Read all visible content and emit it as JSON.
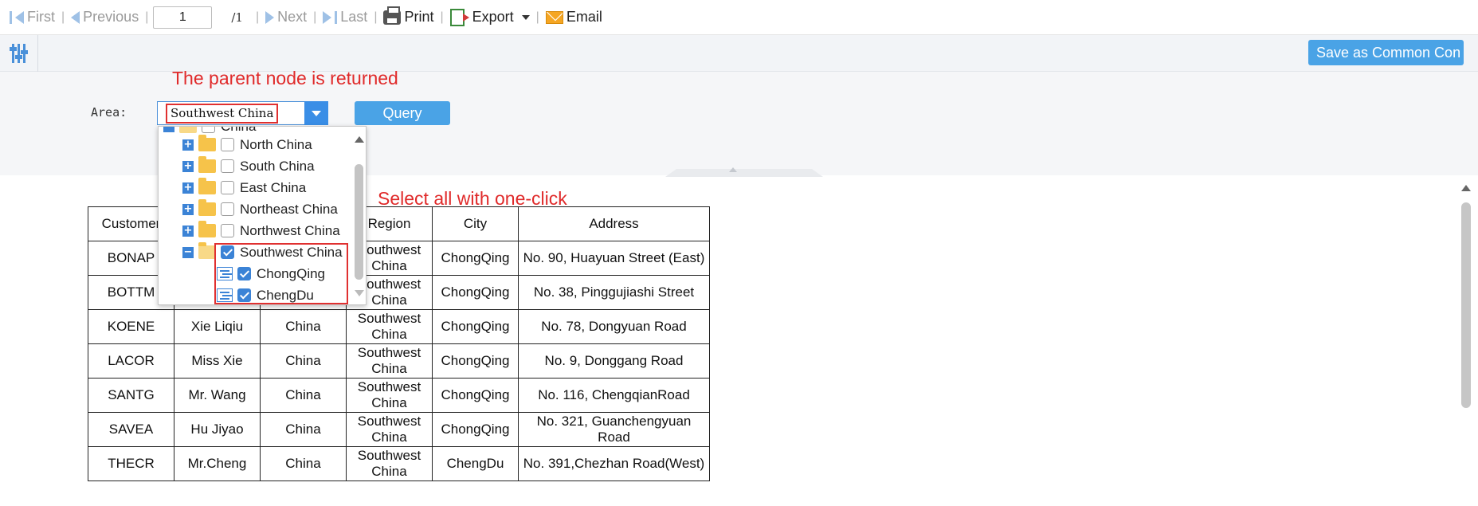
{
  "toolbar": {
    "first": "First",
    "previous": "Previous",
    "page_value": "1",
    "page_total": "/1",
    "next": "Next",
    "last": "Last",
    "print": "Print",
    "export": "Export",
    "email": "Email"
  },
  "param_bar": {
    "save_button": "Save as Common Con"
  },
  "form": {
    "area_label": "Area:",
    "area_value": "Southwest China",
    "query_button": "Query"
  },
  "annotations": {
    "parent_returned": "The parent node is returned",
    "select_all": "Select all with one-click"
  },
  "tree": {
    "items": [
      {
        "label": "China",
        "checked": false
      },
      {
        "label": "North China",
        "checked": false
      },
      {
        "label": "South China",
        "checked": false
      },
      {
        "label": "East China",
        "checked": false
      },
      {
        "label": "Northeast China",
        "checked": false
      },
      {
        "label": "Northwest China",
        "checked": false
      },
      {
        "label": "Southwest China",
        "checked": true
      },
      {
        "label": "ChongQing",
        "checked": true
      },
      {
        "label": "ChengDu",
        "checked": true
      }
    ]
  },
  "table": {
    "headers": [
      "Customer",
      "",
      "",
      "Region",
      "City",
      "Address"
    ],
    "rows": [
      [
        "BONAP",
        "",
        "",
        "Southwest China",
        "ChongQing",
        "No. 90, Huayuan Street (East)"
      ],
      [
        "BOTTM",
        "",
        "",
        "Southwest China",
        "ChongQing",
        "No. 38, Pinggujiashi Street"
      ],
      [
        "KOENE",
        "Xie Liqiu",
        "China",
        "Southwest China",
        "ChongQing",
        "No. 78, Dongyuan Road"
      ],
      [
        "LACOR",
        "Miss Xie",
        "China",
        "Southwest China",
        "ChongQing",
        "No. 9, Donggang Road"
      ],
      [
        "SANTG",
        "Mr. Wang",
        "China",
        "Southwest China",
        "ChongQing",
        "No. 116, ChengqianRoad"
      ],
      [
        "SAVEA",
        "Hu Jiyao",
        "China",
        "Southwest China",
        "ChongQing",
        "No. 321, Guanchengyuan Road"
      ],
      [
        "THECR",
        "Mr.Cheng",
        "China",
        "Southwest China",
        "ChengDu",
        "No. 391,Chezhan Road(West)"
      ]
    ]
  },
  "colors": {
    "accent": "#4aa3e6",
    "annotation": "#e02a2a",
    "checkbox": "#3b83d6"
  }
}
